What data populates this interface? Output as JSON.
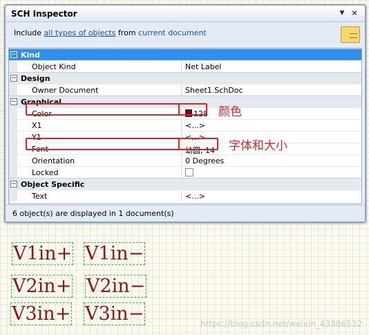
{
  "window": {
    "title": "SCH Inspector",
    "pin_glyph": "▼",
    "close_glyph": "×"
  },
  "filter": {
    "prefix": "Include",
    "scope_link": "all types of objects",
    "middle": "from",
    "source_link": "current document"
  },
  "categories": [
    {
      "label": "Kind",
      "box": "−",
      "selected": true,
      "rows": [
        {
          "name": "Object Kind",
          "value": "Net Label"
        }
      ]
    },
    {
      "label": "Design",
      "box": "−",
      "selected": false,
      "rows": [
        {
          "name": "Owner Document",
          "value": "Sheet1.SchDoc"
        }
      ]
    },
    {
      "label": "Graphical",
      "box": "−",
      "selected": false,
      "rows": [
        {
          "name": "Color",
          "value": "128",
          "swatch": "#800000"
        },
        {
          "name": "X1",
          "value": "<...>"
        },
        {
          "name": "Y1",
          "value": "<...>"
        },
        {
          "name": "Font",
          "value": "幼圆, 14"
        },
        {
          "name": "Orientation",
          "value": "0 Degrees"
        },
        {
          "name": "Locked",
          "value": "",
          "checkbox": true
        }
      ]
    },
    {
      "label": "Object Specific",
      "box": "−",
      "selected": false,
      "rows": [
        {
          "name": "Text",
          "value": "<...>"
        }
      ]
    }
  ],
  "status": "6 object(s) are displayed in 1 document(s)",
  "annotations": {
    "color_note": "颜色",
    "font_note": "字体和大小"
  },
  "net_labels": [
    "V1in+",
    "V1in−",
    "V2in+",
    "V2in−",
    "V3in+",
    "V3in−"
  ],
  "watermark": "https://blog.csdn.net/weixin_43886532",
  "colors": {
    "accent_selected": "#2f8ff0",
    "annotation_red": "#e02424",
    "net_label_text": "#8a1818",
    "net_label_border": "#37c23a"
  }
}
